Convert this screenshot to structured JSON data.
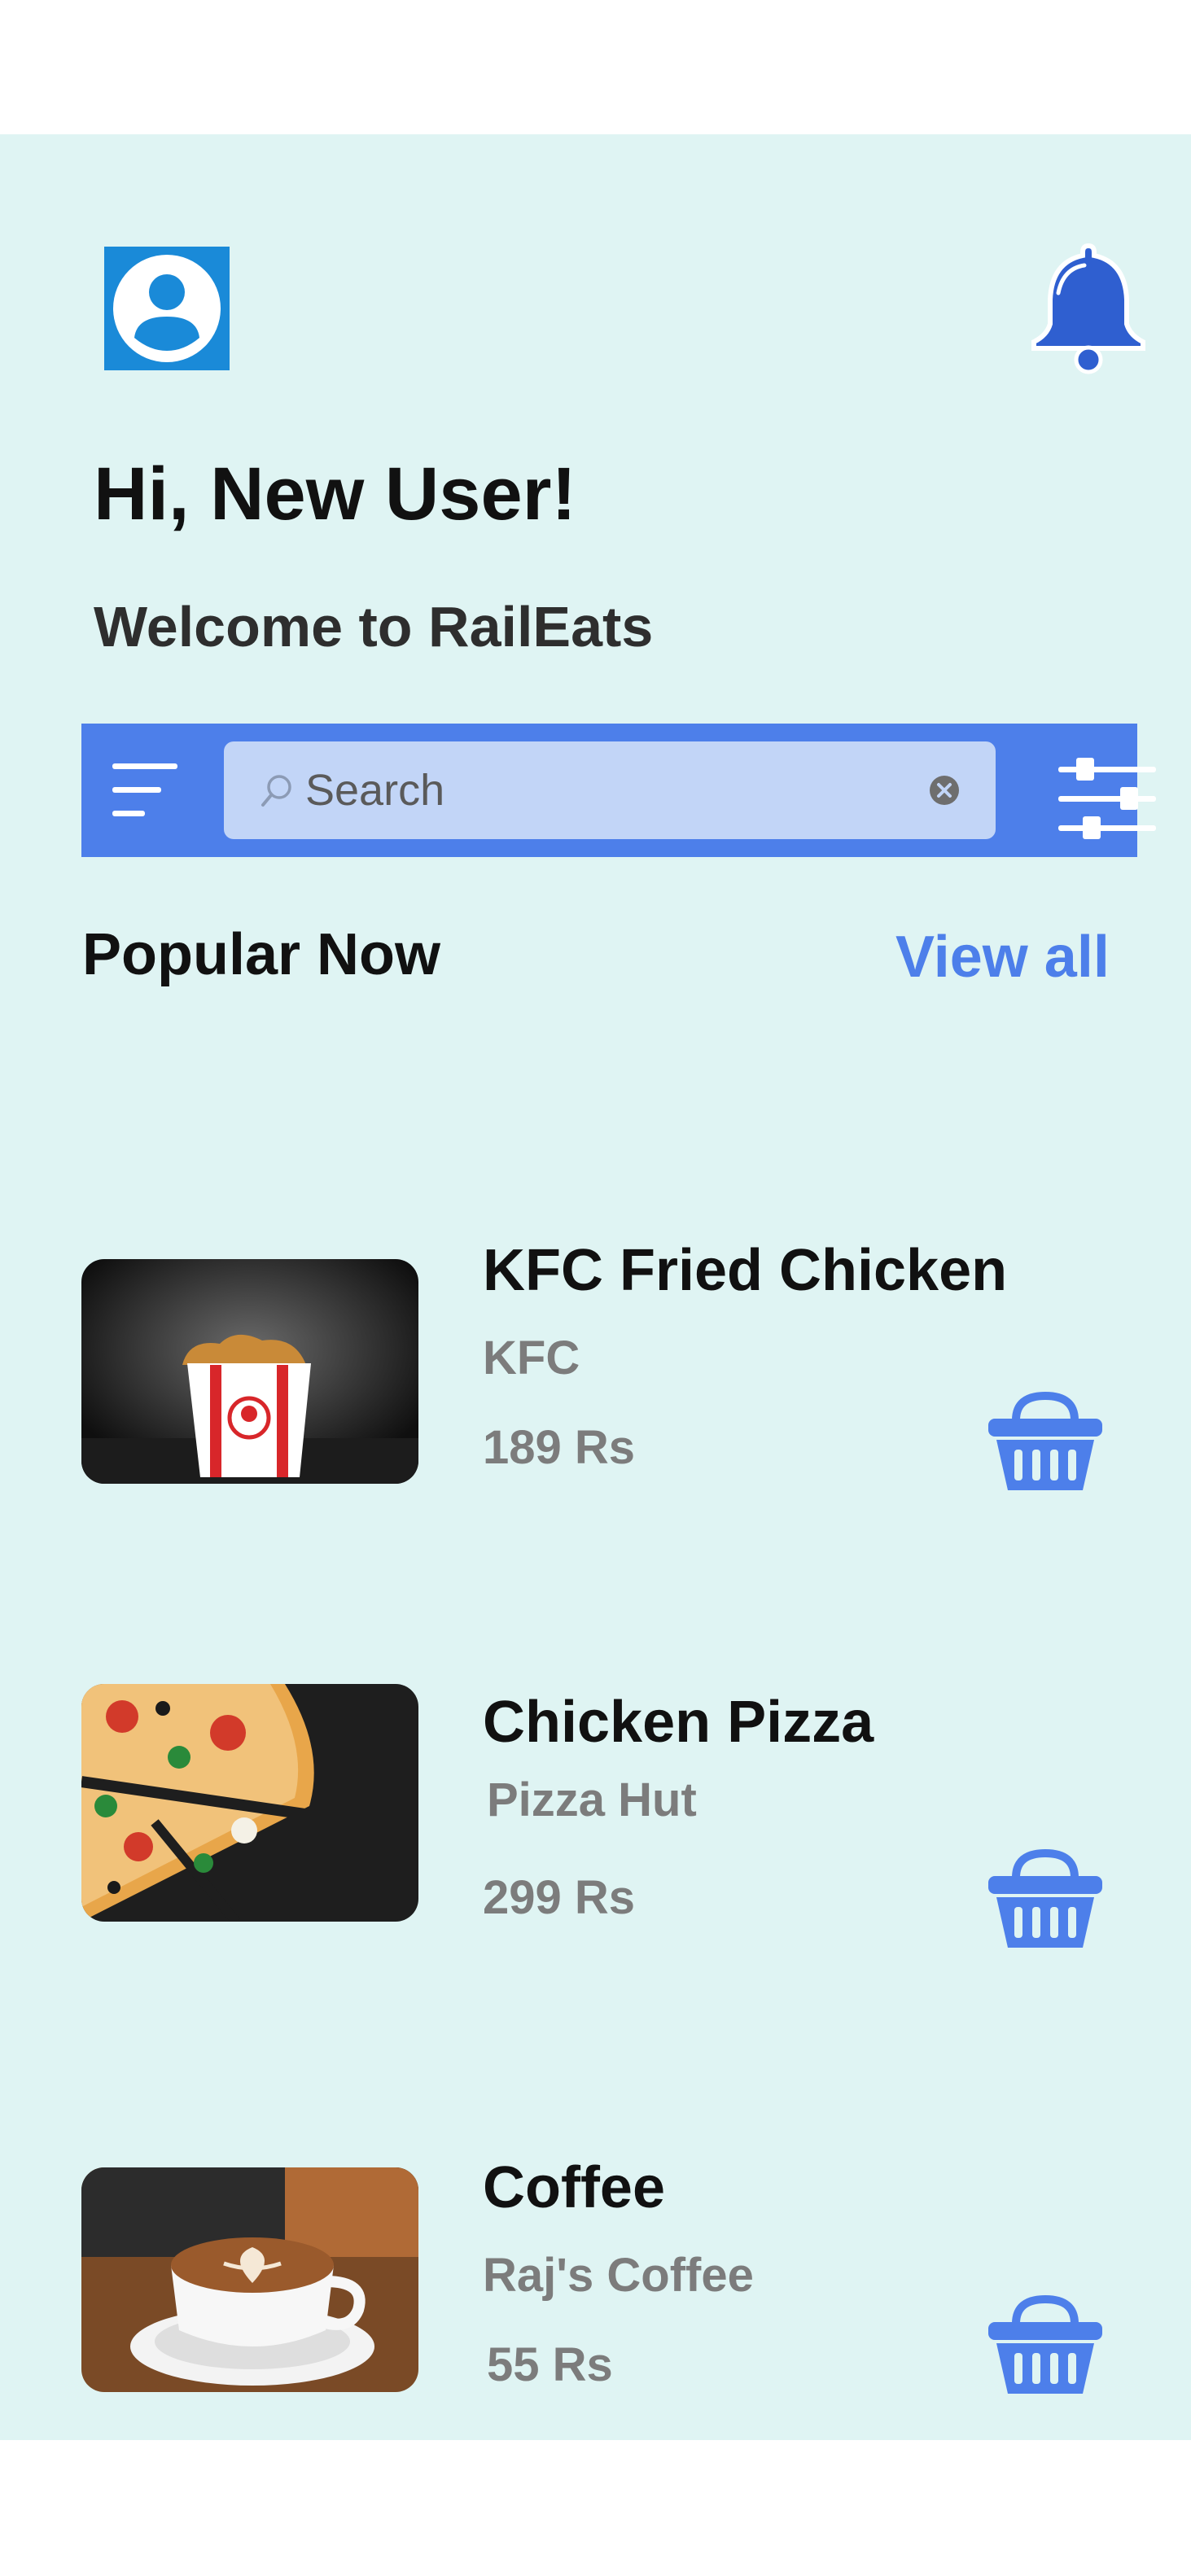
{
  "header": {
    "avatar_icon": "user-avatar-icon",
    "notification_icon": "bell-icon",
    "greeting": "Hi, New User!",
    "welcome": "Welcome to RailEats"
  },
  "search": {
    "placeholder": "Search",
    "menu_icon": "menu-lines-icon",
    "search_icon": "magnifier-icon",
    "clear_icon": "clear-x-icon",
    "filter_icon": "sliders-icon"
  },
  "popular": {
    "title": "Popular Now",
    "view_all": "View all",
    "items": [
      {
        "name": "KFC Fried Chicken",
        "store": "KFC",
        "price": "189 Rs",
        "image": "fried-chicken-bucket-photo"
      },
      {
        "name": "Chicken Pizza",
        "store": "Pizza Hut",
        "price": "299 Rs",
        "image": "pizza-photo"
      },
      {
        "name": "Coffee",
        "store": "Raj's Coffee",
        "price": "55 Rs",
        "image": "latte-art-coffee-photo"
      }
    ]
  },
  "colors": {
    "background": "#dff4f3",
    "accent": "#4d7fea",
    "search_field": "#c2d5f7",
    "avatar": "#1a8ad8",
    "bell": "#2f5fd0"
  }
}
